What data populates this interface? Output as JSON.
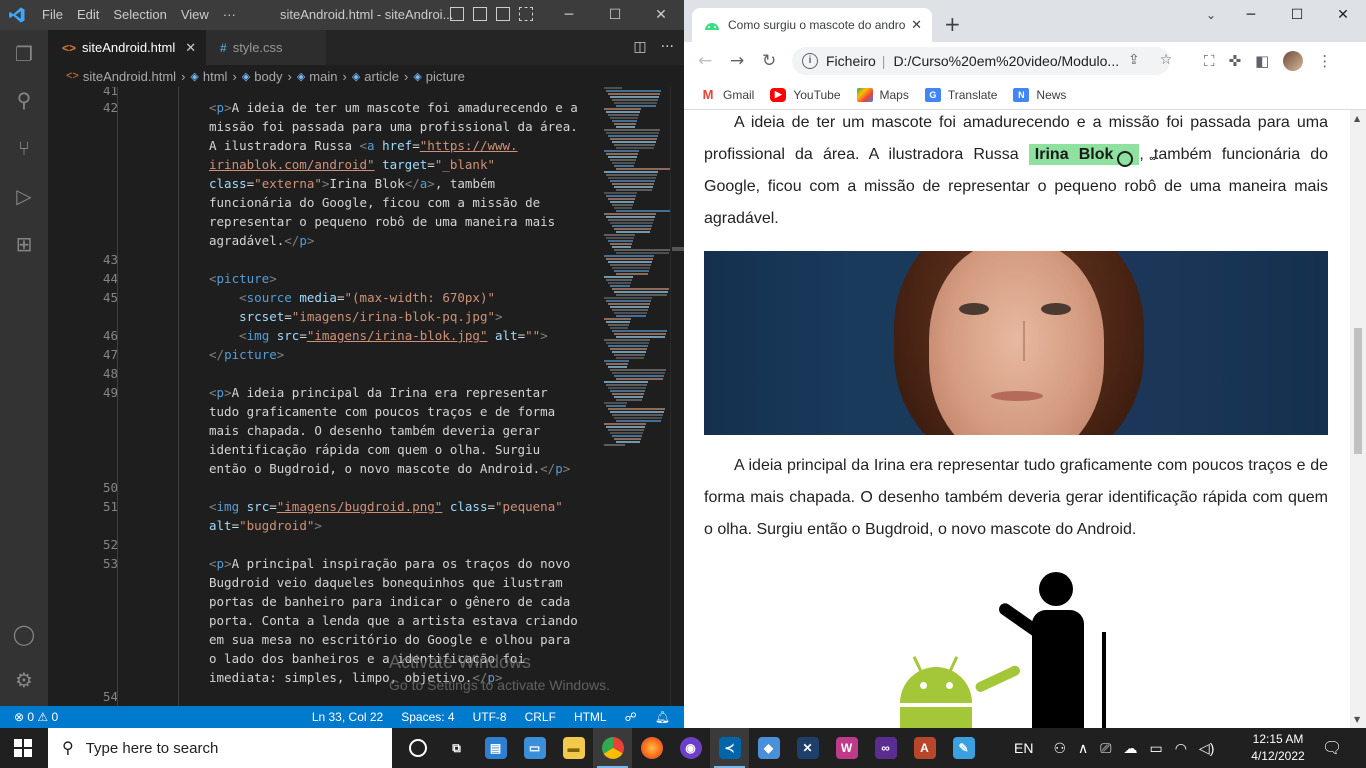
{
  "vscode": {
    "menu": [
      "File",
      "Edit",
      "Selection",
      "View",
      "···"
    ],
    "window_title": "siteAndroid.html - siteAndroi...",
    "tabs": [
      {
        "label": "siteAndroid.html",
        "glyph": "<>",
        "active": true
      },
      {
        "label": "style.css",
        "glyph": "#",
        "active": false
      }
    ],
    "breadcrumb": [
      "siteAndroid.html",
      "html",
      "body",
      "main",
      "article",
      "picture"
    ],
    "line_numbers": [
      "41",
      "42",
      "43",
      "44",
      "45",
      "46",
      "47",
      "48",
      "49",
      "50",
      "51",
      "52",
      "53",
      "54"
    ],
    "code": {
      "l42a": "A ideia de ter um mascote foi amadurecendo e a",
      "l42b": "missão foi passada para uma profissional da área.",
      "l42c": "A ilustradora Russa ",
      "l42d_url1": "\"https://www.",
      "l42e_url2": "irinablok.com/android\"",
      "l42e_target": "\"_blank\"",
      "l42f_class": "\"externa\"",
      "l42f_text": "Irina Blok",
      "l42f_tail": ", também",
      "l42g": "funcionária do Google, ficou com a missão de",
      "l42h": "representar o pequeno robô de uma maneira mais",
      "l42i": "agradável.",
      "l45_media": "\"(max-width: 670px)\"",
      "l45_srcset": "\"imagens/irina-blok-pq.jpg\"",
      "l46_src": "\"imagens/irina-blok.jpg\"",
      "l46_alt": "\"\"",
      "l49a": "A ideia principal da Irina era representar",
      "l49b": "tudo graficamente com poucos traços e de forma",
      "l49c": "mais chapada. O desenho também deveria gerar",
      "l49d": "identificação rápida com quem o olha. Surgiu",
      "l49e": "então o Bugdroid, o novo mascote do Android.",
      "l51_src": "\"imagens/bugdroid.png\"",
      "l51_class": "\"pequena\"",
      "l51_alt": "\"bugdroid\"",
      "l53a": "A principal inspiração para os traços do novo",
      "l53b": "Bugdroid veio daqueles bonequinhos que ilustram",
      "l53c": "portas de banheiro para indicar o gênero de cada",
      "l53d": "porta. Conta a lenda que a artista estava criando",
      "l53e": "em sua mesa no escritório do Google e olhou para",
      "l53f": "o lado dos banheiros e a identificação foi",
      "l53g": "imediata: simples, limpo, objetivo."
    },
    "status": {
      "problems": "⊗ 0 ⚠ 0",
      "position": "Ln 33, Col 22",
      "spaces": "Spaces: 4",
      "encoding": "UTF-8",
      "eol": "CRLF",
      "language": "HTML"
    }
  },
  "chrome": {
    "tab_title": "Como surgiu o mascote do andro",
    "omnibox": {
      "scheme": "Ficheiro",
      "url": "D:/Curso%20em%20video/Modulo..."
    },
    "bookmarks": [
      "Gmail",
      "YouTube",
      "Maps",
      "Translate",
      "News"
    ],
    "page": {
      "p1_before": "A ideia de ter um mascote foi amadurecendo e a missão foi passada para uma profissional da área. A ilustradora Russa ",
      "p1_link": "Irina Blok",
      "p1_after": ", também funcionária do Google, ficou com a missão de representar o pequeno robô de uma maneira mais agradável.",
      "p2": "A ideia principal da Irina era representar tudo graficamente com poucos traços e de forma mais chapada. O desenho também deveria gerar identificação rápida com quem o olha. Surgiu então o Bugdroid, o novo mascote do Android."
    },
    "watermark": {
      "title": "Activate Windows",
      "subtitle": "Go to Settings to activate Windows."
    }
  },
  "taskbar": {
    "search_placeholder": "Type here to search",
    "language": "EN",
    "time": "12:15 AM",
    "date": "4/12/2022"
  }
}
